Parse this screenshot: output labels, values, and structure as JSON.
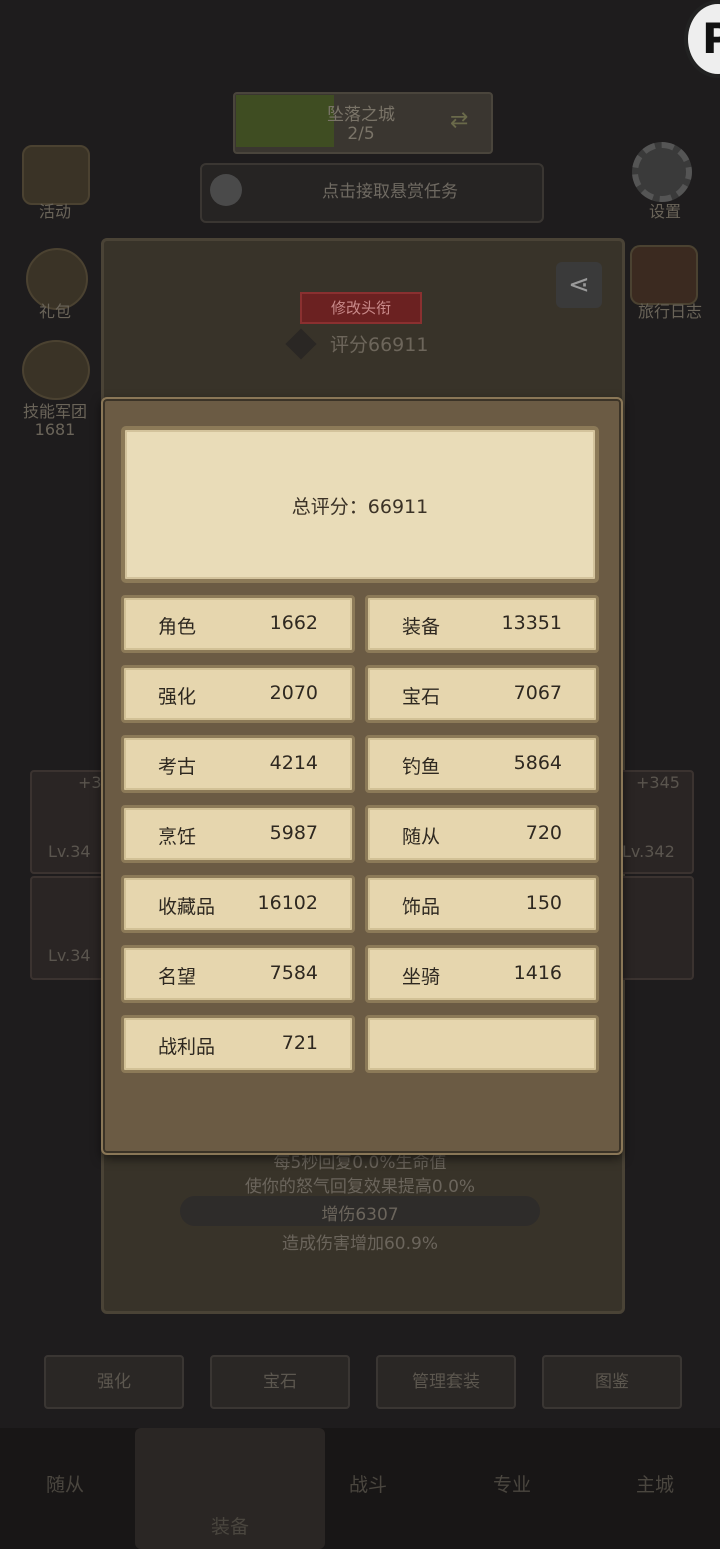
{
  "background": {
    "stage_title": "坠落之城",
    "stage_progress": "2/5",
    "bounty_text": "点击接取悬赏任务",
    "left_icons": [
      {
        "label": "活动",
        "icon": "activity-chest-icon"
      },
      {
        "label": "礼包",
        "icon": "gift-coin-icon"
      },
      {
        "label": "技能军团",
        "icon": "skull-icon"
      },
      {
        "label": "1681",
        "icon": ""
      }
    ],
    "right_icons": [
      {
        "label": "设置",
        "icon": "gear-icon"
      },
      {
        "label": "旅行日志",
        "icon": "book-icon"
      }
    ],
    "title_tag": "修改头衔",
    "score_label": "评分66911",
    "slots": [
      {
        "level": "Lv.34",
        "bonus": "+3"
      },
      {
        "level": "Lv.34",
        "bonus": ""
      },
      {
        "level": "Lv.342",
        "bonus": "+345"
      },
      {
        "level": "",
        "bonus": ""
      }
    ],
    "stats": [
      "每5秒回复0.0%生命值",
      "使你的怒气回复效果提高0.0%",
      "增伤6307",
      "造成伤害增加60.9%"
    ],
    "bottom_buttons": [
      "强化",
      "宝石",
      "管理套装",
      "图鉴"
    ],
    "nav": [
      "随从",
      "装备",
      "战斗",
      "专业",
      "主城"
    ]
  },
  "modal": {
    "total_label": "总评分：66911",
    "items": [
      {
        "label": "角色",
        "value": "1662"
      },
      {
        "label": "装备",
        "value": "13351"
      },
      {
        "label": "强化",
        "value": "2070"
      },
      {
        "label": "宝石",
        "value": "7067"
      },
      {
        "label": "考古",
        "value": "4214"
      },
      {
        "label": "钓鱼",
        "value": "5864"
      },
      {
        "label": "烹饪",
        "value": "5987"
      },
      {
        "label": "随从",
        "value": "720"
      },
      {
        "label": "收藏品",
        "value": "16102"
      },
      {
        "label": "饰品",
        "value": "150"
      },
      {
        "label": "名望",
        "value": "7584"
      },
      {
        "label": "坐骑",
        "value": "1416"
      },
      {
        "label": "战利品",
        "value": "721"
      },
      {
        "label": "",
        "value": ""
      }
    ]
  },
  "overlay_logo": "P",
  "colors": {
    "modal_bg": "#6b5b44",
    "card_bg": "#e6d6ae",
    "card_border": "#8c7a58",
    "page_bg": "#1e1c1d"
  }
}
